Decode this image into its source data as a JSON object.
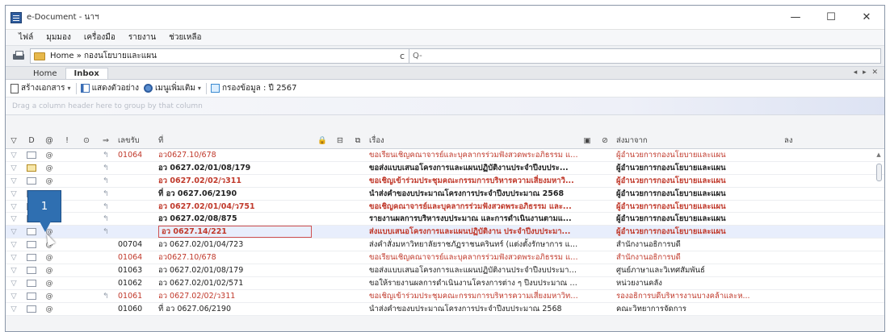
{
  "window": {
    "title": "e-Document - นาฯ",
    "controls": {
      "minimize": "—",
      "maximize": "☐",
      "close": "✕"
    }
  },
  "menu": [
    "ไฟล์",
    "มุมมอง",
    "เครื่องมือ",
    "รายงาน",
    "ช่วยเหลือ"
  ],
  "address": {
    "path": "Home » กองนโยบายและแผน",
    "search_placeholder": "Q-",
    "refresh_icon": "refresh-icon"
  },
  "tabs": [
    {
      "label": "Home",
      "active": false
    },
    {
      "label": "Inbox",
      "active": true
    }
  ],
  "tab_nav": "◂ ▸ ✕",
  "toolbar": {
    "create": "สร้างเอกสาร",
    "preview": "แสดงตัวอย่าง",
    "more": "เมนูเพิ่มเติม",
    "filter": "กรองข้อมูล : ปี 2567"
  },
  "group_hint": "Drag a column header here to group by that column",
  "columns": {
    "flag": "▽",
    "type": "D",
    "att": "@",
    "imp": "!",
    "stat": "⊙",
    "reply": "⇒",
    "recv": "เลขรับ",
    "no": "ที่",
    "lock": "🔒",
    "box": "⊟",
    "copy": "⧉",
    "subj": "เรื่อง",
    "m1": "▣",
    "m2": "⊘",
    "from": "ส่งมาจาก",
    "extra": "ลง"
  },
  "rows": [
    {
      "type": "open",
      "reply": true,
      "recv": "01064",
      "no": "อว0627.10/678",
      "subject": "ขอเรียนเชิญคณาจารย์และบุคลากรร่วมฟังสวดพระอภิธรรม และร่...",
      "from": "ผู้อำนวยการกองนโยบายและแผน",
      "style": "red"
    },
    {
      "type": "new",
      "reply": true,
      "recv": "",
      "no": "อว 0627.02/01/08/179",
      "subject": "ขอส่งแบบเสนอโครงการและแผนปฏิบัติงานประจำปีงบประ...",
      "from": "ผู้อำนวยการกองนโยบายและแผน",
      "style": "bold"
    },
    {
      "type": "open",
      "reply": true,
      "recv": "",
      "no": "อว 0627.02/02/ว311",
      "subject": "ขอเชิญเข้าร่วมประชุมคณะกรรมการบริหารความเสี่ยงมหาวิ...",
      "from": "ผู้อำนวยการกองนโยบายและแผน",
      "style": "bold-red"
    },
    {
      "type": "open",
      "reply": true,
      "recv": "",
      "no": "ที่ อว 0627.06/2190",
      "subject": "นำส่งคำของบประมาณโครงการประจำปีงบประมาณ 2568",
      "from": "ผู้อำนวยการกองนโยบายและแผน",
      "style": "bold"
    },
    {
      "type": "open",
      "reply": true,
      "recv": "",
      "no": "อว 0627.02/01/04/ว751",
      "subject": "ขอเชิญคณาจารย์และบุคลากรร่วมฟังสวดพระอภิธรรม และ...",
      "from": "ผู้อำนวยการกองนโยบายและแผน",
      "style": "bold-red"
    },
    {
      "type": "open",
      "reply": true,
      "recv": "",
      "no": "อว 0627.02/08/875",
      "subject": "รายงานผลการบริหารงบประมาณ และการดำเนินงานตามแ...",
      "from": "ผู้อำนวยการกองนโยบายและแผน",
      "style": "bold"
    },
    {
      "type": "open",
      "reply": true,
      "recv": "",
      "no": "อว 0627.14/221",
      "subject": "ส่งแบบเสนอโครงการและแผนปฏิบัติงาน ประจำปีงบประมา...",
      "from": "ผู้อำนวยการกองนโยบายและแผน",
      "style": "bold-red",
      "selected": true
    },
    {
      "type": "open",
      "reply": false,
      "recv": "00704",
      "no": "อว 0627.02/01/04/723",
      "subject": "ส่งคำสั่งมหาวิทยาลัยราชภัฏราชนครินทร์ (แต่งตั้งรักษาการ และ...",
      "from": "สำนักงานอธิการบดี",
      "style": "normal"
    },
    {
      "type": "open",
      "reply": false,
      "recv": "01064",
      "no": "อว0627.10/678",
      "subject": "ขอเรียนเชิญคณาจารย์และบุคลากรร่วมฟังสวดพระอภิธรรม และร่...",
      "from": "สำนักงานอธิการบดี",
      "style": "red"
    },
    {
      "type": "open",
      "reply": false,
      "recv": "01063",
      "no": "อว 0627.02/01/08/179",
      "subject": "ขอส่งแบบเสนอโครงการและแผนปฏิบัติงานประจำปีงบประมาณ ...",
      "from": "ศูนย์ภาษาและวิเทศสัมพันธ์",
      "style": "normal"
    },
    {
      "type": "open",
      "reply": false,
      "recv": "01062",
      "no": "อว 0627.02/01/02/571",
      "subject": "ขอให้รายงานผลการดำเนินงานโครงการต่าง ๆ ปีงบประมาณ พ.ศ....",
      "from": "หน่วยงานคลัง",
      "style": "normal"
    },
    {
      "type": "open",
      "reply": true,
      "recv": "01061",
      "no": "อว 0627.02/02/ว311",
      "subject": "ขอเชิญเข้าร่วมประชุมคณะกรรมการบริหารความเสี่ยงมหาวิทยาลั...",
      "from": "รองอธิการบดีบริหารงานบางคล้าและห...",
      "style": "red"
    },
    {
      "type": "open",
      "reply": false,
      "recv": "01060",
      "no": "ที่ อว 0627.06/2190",
      "subject": "นำส่งคำของบประมาณโครงการประจำปีงบประมาณ 2568",
      "from": "คณะวิทยาการจัดการ",
      "style": "normal"
    }
  ],
  "callout": "1",
  "colors": {
    "red": "#c0392b",
    "selected": "#e8eefc",
    "callout": "#2f6fb1"
  }
}
